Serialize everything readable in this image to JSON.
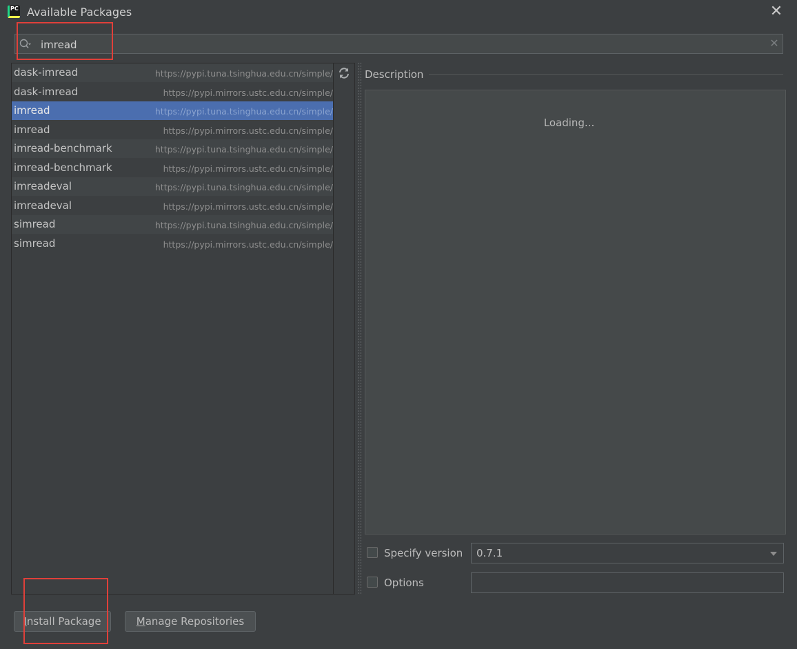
{
  "window": {
    "app_icon_label": "PC",
    "title": "Available Packages",
    "close_glyph": "✕"
  },
  "search": {
    "value": "imread",
    "clear_glyph": "✕"
  },
  "packages": [
    {
      "name": "dask-imread",
      "repo": "https://pypi.tuna.tsinghua.edu.cn/simple/"
    },
    {
      "name": "dask-imread",
      "repo": "https://pypi.mirrors.ustc.edu.cn/simple/"
    },
    {
      "name": "imread",
      "repo": "https://pypi.tuna.tsinghua.edu.cn/simple/",
      "selected": true
    },
    {
      "name": "imread",
      "repo": "https://pypi.mirrors.ustc.edu.cn/simple/"
    },
    {
      "name": "imread-benchmark",
      "repo": "https://pypi.tuna.tsinghua.edu.cn/simple/"
    },
    {
      "name": "imread-benchmark",
      "repo": "https://pypi.mirrors.ustc.edu.cn/simple/"
    },
    {
      "name": "imreadeval",
      "repo": "https://pypi.tuna.tsinghua.edu.cn/simple/"
    },
    {
      "name": "imreadeval",
      "repo": "https://pypi.mirrors.ustc.edu.cn/simple/"
    },
    {
      "name": "simread",
      "repo": "https://pypi.tuna.tsinghua.edu.cn/simple/"
    },
    {
      "name": "simread",
      "repo": "https://pypi.mirrors.ustc.edu.cn/simple/"
    }
  ],
  "description": {
    "label": "Description",
    "status": "Loading..."
  },
  "options": {
    "specify_version_label": "Specify version",
    "version_value": "0.7.1",
    "options_label": "Options",
    "options_value": ""
  },
  "buttons": {
    "install": "Install Package",
    "manage": "Manage Repositories"
  },
  "colors": {
    "background": "#3c3f41",
    "selection": "#4b6eaf",
    "annotation": "#e0403a"
  },
  "icons": [
    "pycharm-logo-icon",
    "close-icon",
    "search-icon",
    "clear-icon",
    "refresh-icon",
    "dropdown-arrow-icon"
  ]
}
